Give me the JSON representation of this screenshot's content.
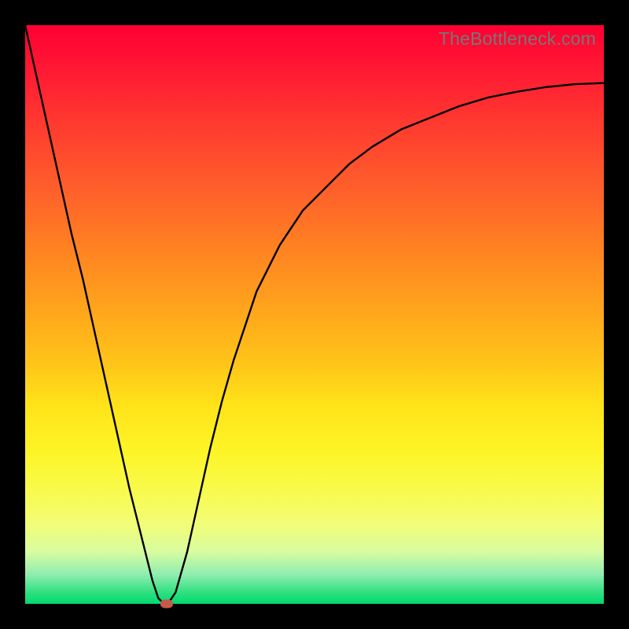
{
  "watermark": "TheBottleneck.com",
  "chart_data": {
    "type": "line",
    "title": "",
    "xlabel": "",
    "ylabel": "",
    "xlim": [
      0,
      100
    ],
    "ylim": [
      0,
      100
    ],
    "gradient_background": {
      "top_color": "#ff0033",
      "mid_color": "#ffe419",
      "bottom_color": "#00d96f"
    },
    "x": [
      0,
      2,
      4,
      6,
      8,
      10,
      12,
      14,
      16,
      18,
      20,
      22,
      23,
      24,
      25,
      26,
      28,
      30,
      32,
      34,
      36,
      38,
      40,
      44,
      48,
      52,
      56,
      60,
      65,
      70,
      75,
      80,
      85,
      90,
      95,
      100
    ],
    "y": [
      100,
      91,
      82,
      73,
      64,
      56,
      47,
      38,
      29,
      20,
      12,
      4,
      1,
      0,
      0.5,
      2,
      9,
      18,
      27,
      35,
      42,
      48,
      54,
      62,
      68,
      72,
      76,
      79,
      82,
      84,
      86,
      87.5,
      88.5,
      89.3,
      89.8,
      90
    ],
    "marker": {
      "x": 24.5,
      "y": 0
    },
    "annotations": []
  }
}
